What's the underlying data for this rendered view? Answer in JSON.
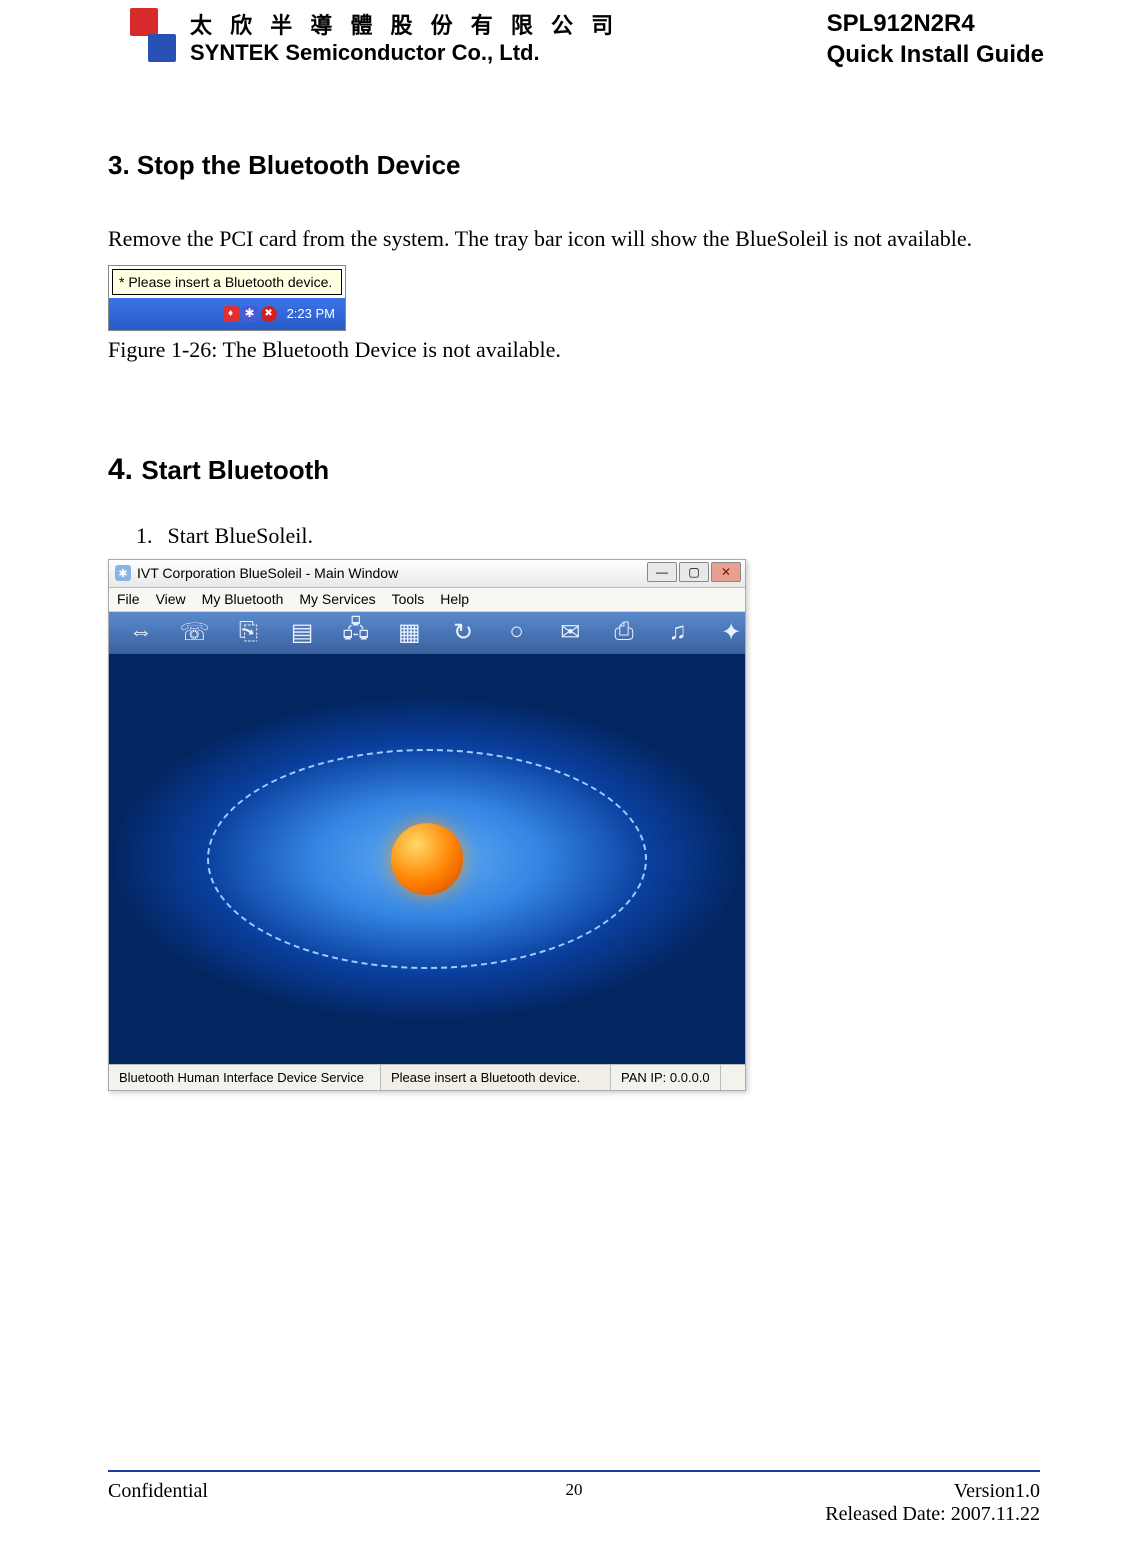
{
  "header": {
    "company_chinese": "太 欣 半 導 體 股 份 有 限 公 司",
    "company_english": "SYNTEK Semiconductor Co., Ltd.",
    "product": "SPL912N2R4",
    "doc_type": "Quick Install Guide"
  },
  "section3": {
    "heading": "3. Stop the Bluetooth Device",
    "body": "Remove the PCI card from the system. The tray bar icon will show the BlueSoleil is not available.",
    "tooltip_text": "* Please insert a Bluetooth device.",
    "tray_time": "2:23 PM",
    "caption": "Figure 1-26: The Bluetooth Device is not available."
  },
  "section4": {
    "heading_num": "4. ",
    "heading_txt": "Start Bluetooth",
    "step1_num": "1.",
    "step1_txt": "Start BlueSoleil."
  },
  "app_window": {
    "title": "IVT Corporation BlueSoleil - Main Window",
    "menu": [
      "File",
      "View",
      "My Bluetooth",
      "My Services",
      "Tools",
      "Help"
    ],
    "status": {
      "service": "Bluetooth Human Interface Device Service",
      "message": "Please insert a Bluetooth device.",
      "pan_ip": "PAN IP: 0.0.0.0"
    }
  },
  "footer": {
    "left": "Confidential",
    "page": "20",
    "version": "Version1.0",
    "date": "Released Date: 2007.11.22"
  }
}
